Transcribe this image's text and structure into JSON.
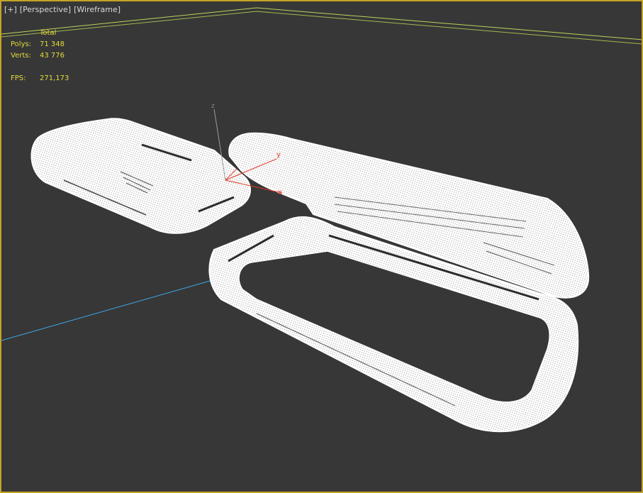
{
  "viewport": {
    "labels": {
      "plus": "[+]",
      "view": "[Perspective]",
      "shading": "[Wireframe]"
    },
    "stats": {
      "header": "Total",
      "polys_label": "Polys:",
      "polys_value": "71 348",
      "verts_label": "Verts:",
      "verts_value": "43 776",
      "fps_label": "FPS:",
      "fps_value": "271,173"
    },
    "gizmo": {
      "x_label": "x",
      "y_label": "y",
      "z_label": "z"
    },
    "colors": {
      "background": "#373737",
      "border": "#c6a325",
      "stats_text": "#e3dc3a",
      "grid_line": "#b8d65a",
      "axis_line": "#3fa9e8",
      "wireframe": "#ffffff"
    }
  }
}
